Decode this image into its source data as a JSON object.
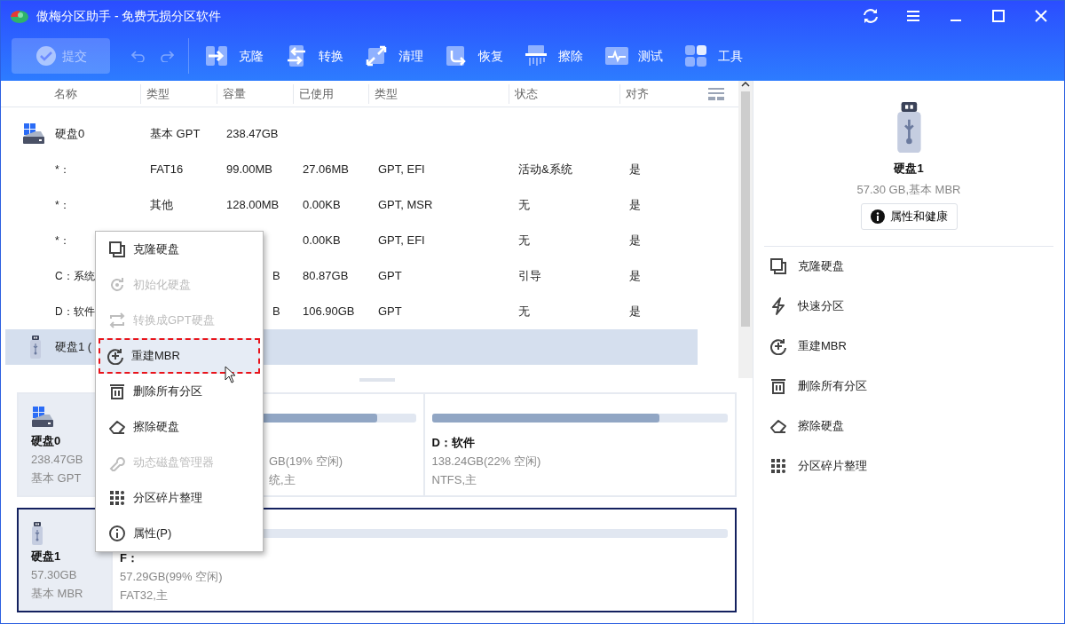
{
  "window": {
    "title": "傲梅分区助手 - 免费无损分区软件"
  },
  "toolbar": {
    "submit": {
      "label": "提交",
      "disabled": true
    },
    "undo_disabled": true,
    "redo_disabled": true,
    "tools": [
      "克隆",
      "转换",
      "清理",
      "恢复",
      "擦除",
      "测试",
      "工具"
    ]
  },
  "table": {
    "columns": [
      "名称",
      "类型",
      "容量",
      "已使用",
      "类型",
      "状态",
      "对齐"
    ],
    "rows": [
      {
        "kind": "hdd",
        "name": "硬盘0",
        "type": "基本 GPT",
        "capacity": "238.47GB",
        "selected": false
      },
      {
        "kind": "partition",
        "name": "*：",
        "type": "FAT16",
        "capacity": "99.00MB",
        "used": "27.06MB",
        "fs": "GPT, EFI",
        "status": "活动&系统",
        "align": "是",
        "selected": false
      },
      {
        "kind": "partition",
        "name": "*：",
        "type": "其他",
        "capacity": "128.00MB",
        "used": "0.00KB",
        "fs": "GPT, MSR",
        "status": "无",
        "align": "是",
        "selected": false
      },
      {
        "kind": "partition",
        "name": "*：",
        "used": "0.00KB",
        "fs": "GPT, EFI",
        "status": "无",
        "align": "是",
        "selected": false
      },
      {
        "kind": "partition",
        "name": "C：系统",
        "capacity": "B",
        "used": "80.87GB",
        "fs": "GPT",
        "status": "引导",
        "align": "是",
        "selected": false
      },
      {
        "kind": "partition",
        "name": "D：软件",
        "capacity": "B",
        "used": "106.90GB",
        "fs": "GPT",
        "status": "无",
        "align": "是",
        "selected": false
      },
      {
        "kind": "usb",
        "name": "硬盘1 (",
        "selected": true
      }
    ]
  },
  "context_menu": [
    {
      "label": "克隆硬盘",
      "disabled": false,
      "selected": false
    },
    {
      "label": "初始化硬盘",
      "disabled": true,
      "selected": false
    },
    {
      "label": "转换成GPT硬盘",
      "disabled": true,
      "selected": false
    },
    {
      "label": "重建MBR",
      "disabled": false,
      "selected": true
    },
    {
      "label": "删除所有分区",
      "disabled": false,
      "selected": false
    },
    {
      "label": "擦除硬盘",
      "disabled": false,
      "selected": false
    },
    {
      "label": "动态磁盘管理器",
      "disabled": true,
      "selected": false
    },
    {
      "label": "分区碎片整理",
      "disabled": false,
      "selected": false
    },
    {
      "label": "属性(P)",
      "disabled": false,
      "selected": false
    }
  ],
  "disk_cards": [
    {
      "kind": "hdd",
      "name": "硬盘0",
      "size": "238.47GB",
      "style": "基本 GPT",
      "selected": false,
      "partitions": [
        {
          "detail": "GB(19% 空闲)",
          "fs": "统,主",
          "level": 0.87
        },
        {
          "name": "D：软件",
          "detail": "138.24GB(22% 空闲)",
          "fs": "NTFS,主",
          "level": 0.77
        }
      ]
    },
    {
      "kind": "usb",
      "name": "硬盘1",
      "size": "57.30GB",
      "style": "基本 MBR",
      "selected": true,
      "partitions": [
        {
          "name": "F：",
          "detail": "57.29GB(99% 空闲)",
          "fs": "FAT32,主"
        }
      ]
    }
  ],
  "details": {
    "name": "硬盘1",
    "info": "57.30 GB,基本 MBR",
    "button": "属性和健康",
    "actions": [
      "克隆硬盘",
      "快速分区",
      "重建MBR",
      "删除所有分区",
      "擦除硬盘",
      "分区碎片整理"
    ]
  }
}
